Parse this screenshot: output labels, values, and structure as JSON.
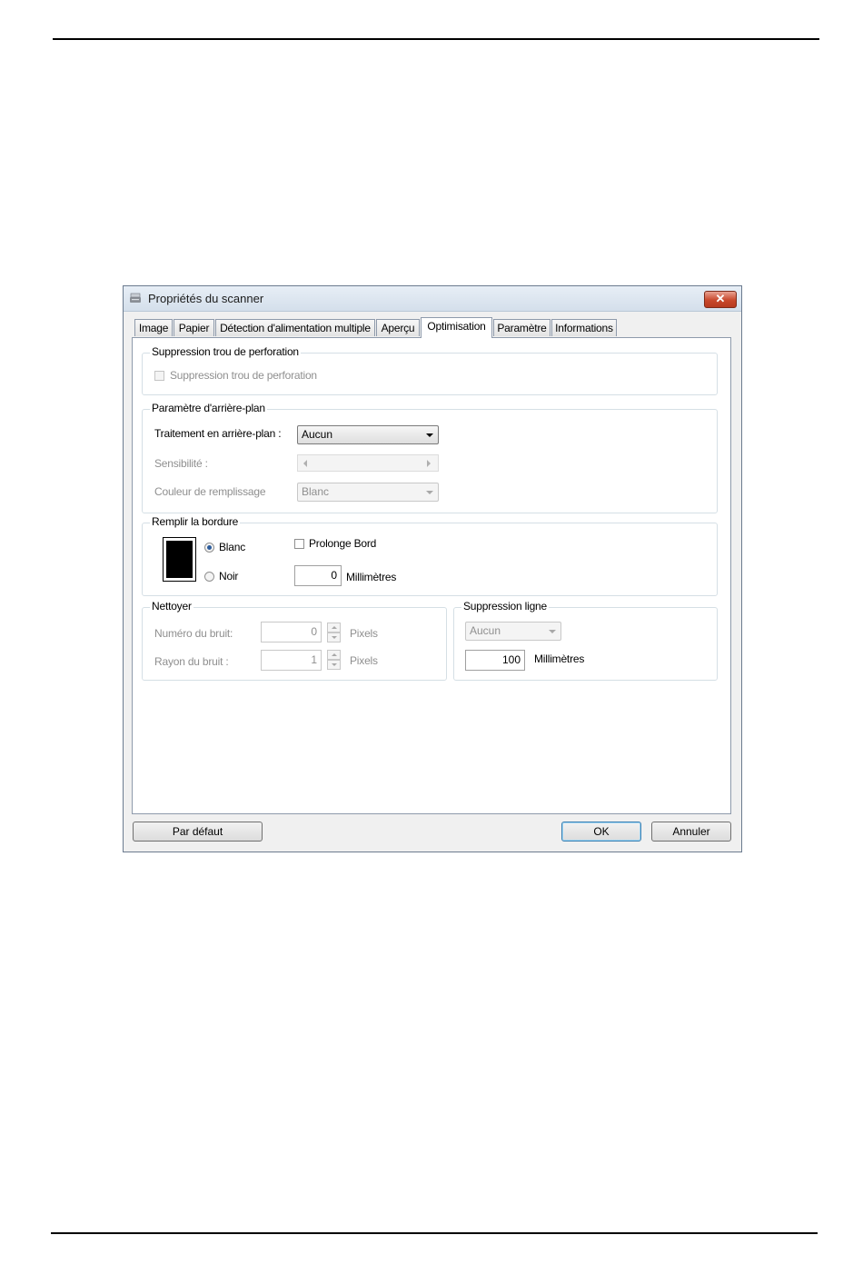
{
  "window": {
    "title": "Propriétés du scanner",
    "close_glyph": "✕"
  },
  "tabs": [
    {
      "label": "Image"
    },
    {
      "label": "Papier"
    },
    {
      "label": "Détection d'alimentation multiple"
    },
    {
      "label": "Aperçu"
    },
    {
      "label": "Optimisation",
      "active": true
    },
    {
      "label": "Paramètre"
    },
    {
      "label": "Informations"
    }
  ],
  "perforation": {
    "legend": "Suppression trou de perforation",
    "checkbox_label": "Suppression trou de perforation",
    "checked": false
  },
  "background": {
    "legend": "Paramètre d'arrière-plan",
    "processing_label": "Traitement en arrière-plan :",
    "processing_value": "Aucun",
    "sensitivity_label": "Sensibilité :",
    "fill_color_label": "Couleur de remplissage",
    "fill_color_value": "Blanc"
  },
  "border": {
    "legend": "Remplir la bordure",
    "white_label": "Blanc",
    "black_label": "Noir",
    "selected": "Blanc",
    "extend_label": "Prolonge Bord",
    "extend_checked": false,
    "mm_value": "0",
    "mm_label": "Millimètres"
  },
  "clean": {
    "legend": "Nettoyer",
    "noise_number_label": "Numéro du bruit:",
    "noise_number_value": "0",
    "noise_number_unit": "Pixels",
    "noise_radius_label": "Rayon du bruit :",
    "noise_radius_value": "1",
    "noise_radius_unit": "Pixels"
  },
  "line_removal": {
    "legend": "Suppression ligne",
    "value": "Aucun",
    "mm_value": "100",
    "mm_label": "Millimètres"
  },
  "buttons": {
    "default_label": "Par défaut",
    "ok_label": "OK",
    "cancel_label": "Annuler"
  },
  "icons": {
    "app": "scanner-icon",
    "close": "close-icon"
  }
}
